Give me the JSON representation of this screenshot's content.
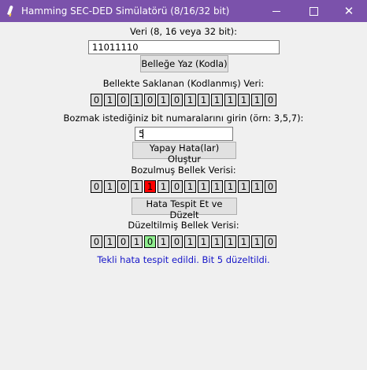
{
  "window": {
    "title": "Hamming SEC-DED Simülatörü (8/16/32 bit)",
    "minimize_icon": "minimize-icon",
    "maximize_icon": "maximize-icon",
    "close_icon": "close-icon",
    "close_glyph": "✕"
  },
  "input_section": {
    "label": "Veri (8, 16 veya 32 bit):",
    "value": "11011110",
    "encode_button": "Belleğe Yaz (Kodla)"
  },
  "stored": {
    "label": "Bellekte Saklanan (Kodlanmış) Veri:",
    "bits": [
      "0",
      "1",
      "0",
      "1",
      "0",
      "1",
      "0",
      "1",
      "1",
      "1",
      "1",
      "1",
      "1",
      "0"
    ]
  },
  "corrupt_input": {
    "label": "Bozmak istediğiniz bit numaralarını girin (örn: 3,5,7):",
    "value": "5",
    "button": "Yapay Hata(lar) Oluştur"
  },
  "corrupted": {
    "label": "Bozulmuş Bellek Verisi:",
    "bits": [
      "0",
      "1",
      "0",
      "1",
      "1",
      "1",
      "0",
      "1",
      "1",
      "1",
      "1",
      "1",
      "1",
      "0"
    ],
    "error_index": 4,
    "error_color": "#ff0000",
    "fix_button": "Hata Tespit Et ve Düzelt"
  },
  "corrected": {
    "label": "Düzeltilmiş Bellek Verisi:",
    "bits": [
      "0",
      "1",
      "0",
      "1",
      "0",
      "1",
      "0",
      "1",
      "1",
      "1",
      "1",
      "1",
      "1",
      "0"
    ],
    "fixed_index": 4,
    "fixed_color": "#90ee90"
  },
  "status": {
    "message": "Tekli hata tespit edildi. Bit 5 düzeltildi.",
    "color": "#1515c8"
  },
  "colors": {
    "titlebar": "#7b52ab",
    "background": "#f0f0f0",
    "bit_cell": "#dddddd"
  }
}
